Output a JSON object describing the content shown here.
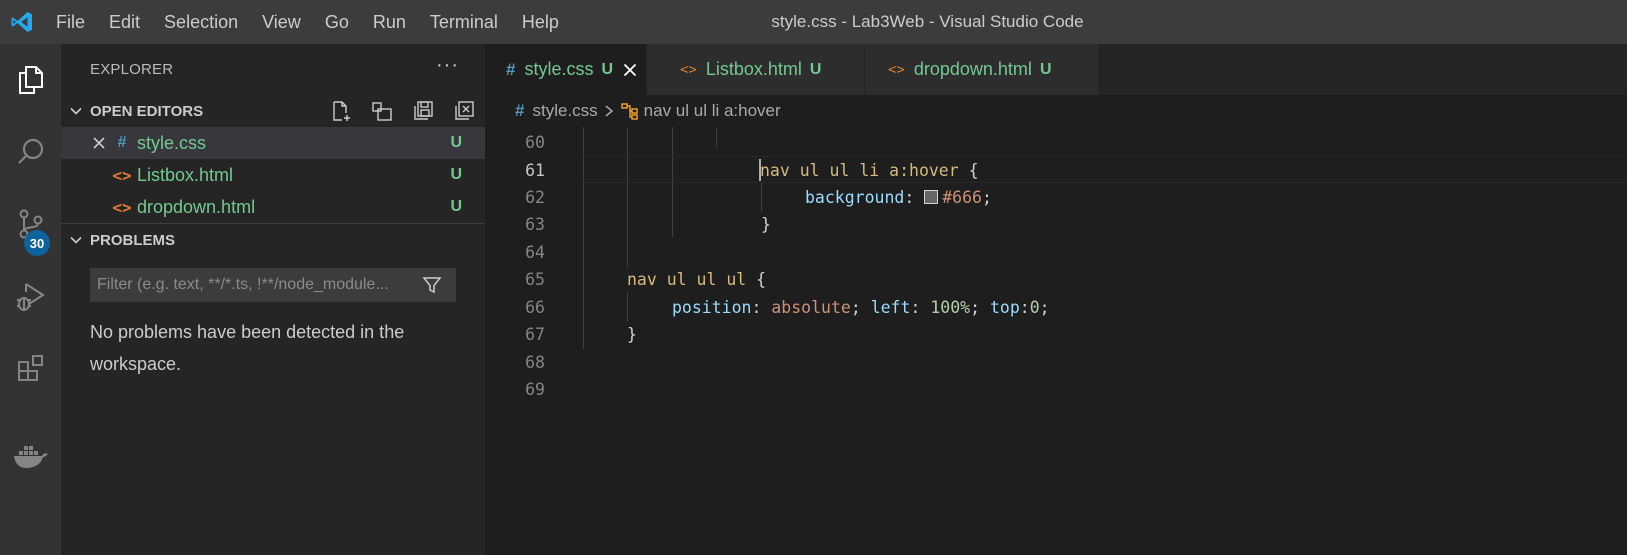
{
  "window": {
    "title": "style.css - Lab3Web - Visual Studio Code"
  },
  "menu": [
    "File",
    "Edit",
    "Selection",
    "View",
    "Go",
    "Run",
    "Terminal",
    "Help"
  ],
  "activity_bar": {
    "items": [
      "explorer",
      "search",
      "source-control",
      "run-debug",
      "extensions",
      "docker"
    ],
    "source_control_badge": "30"
  },
  "sidebar": {
    "title": "EXPLORER",
    "more": "···",
    "open_editors": {
      "label": "OPEN EDITORS",
      "files": [
        {
          "name": "style.css",
          "type": "css",
          "icon": "#",
          "badge": "U",
          "active": true
        },
        {
          "name": "Listbox.html",
          "type": "html",
          "icon": "<>",
          "badge": "U",
          "active": false
        },
        {
          "name": "dropdown.html",
          "type": "html",
          "icon": "<>",
          "badge": "U",
          "active": false
        }
      ]
    },
    "problems": {
      "label": "PROBLEMS",
      "filter_placeholder": "Filter (e.g. text, **/*.ts, !**/node_module...",
      "message": "No problems have been detected in the workspace."
    }
  },
  "tabs": [
    {
      "label": "style.css",
      "icon": "#",
      "badge": "U",
      "active": true
    },
    {
      "label": "Listbox.html",
      "icon": "<>",
      "badge": "U",
      "active": false
    },
    {
      "label": "dropdown.html",
      "icon": "<>",
      "badge": "U",
      "active": false
    }
  ],
  "breadcrumb": {
    "file": "style.css",
    "file_icon": "#",
    "symbol": "nav ul ul li a:hover"
  },
  "editor": {
    "current_line": 61,
    "lines": [
      {
        "n": "60",
        "tokens": []
      },
      {
        "n": "61",
        "tokens": [
          [
            "sel",
            "nav ul ul li a:hover "
          ],
          [
            "brace",
            "{"
          ]
        ]
      },
      {
        "n": "62",
        "tokens": [
          [
            "prop",
            "background"
          ],
          [
            "punc",
            ": "
          ],
          [
            "swatch",
            ""
          ],
          [
            "pval",
            "#666"
          ],
          [
            "punc",
            ";"
          ]
        ]
      },
      {
        "n": "63",
        "tokens": [
          [
            "brace",
            "}"
          ]
        ]
      },
      {
        "n": "64",
        "tokens": []
      },
      {
        "n": "65",
        "tokens": [
          [
            "sel",
            "nav ul ul ul "
          ],
          [
            "brace",
            "{"
          ]
        ]
      },
      {
        "n": "66",
        "tokens": [
          [
            "prop",
            "position"
          ],
          [
            "punc",
            ": "
          ],
          [
            "pval",
            "absolute"
          ],
          [
            "punc",
            "; "
          ],
          [
            "prop",
            "left"
          ],
          [
            "punc",
            ": "
          ],
          [
            "num",
            "100%"
          ],
          [
            "punc",
            "; "
          ],
          [
            "prop",
            "top"
          ],
          [
            "punc",
            ":"
          ],
          [
            "num",
            "0"
          ],
          [
            "punc",
            ";"
          ]
        ]
      },
      {
        "n": "67",
        "tokens": [
          [
            "brace",
            "}"
          ]
        ]
      },
      {
        "n": "68",
        "tokens": []
      },
      {
        "n": "69",
        "tokens": []
      }
    ]
  },
  "colors": {
    "title_bar": "#3c3c3c",
    "activity_bar": "#333333",
    "sidebar": "#252526",
    "editor": "#1e1e1e",
    "untracked_green": "#73c991",
    "css_icon_blue": "#519aba",
    "html_icon_orange": "#e37933",
    "badge_blue": "#0e639c",
    "swatch_color": "#666666"
  }
}
